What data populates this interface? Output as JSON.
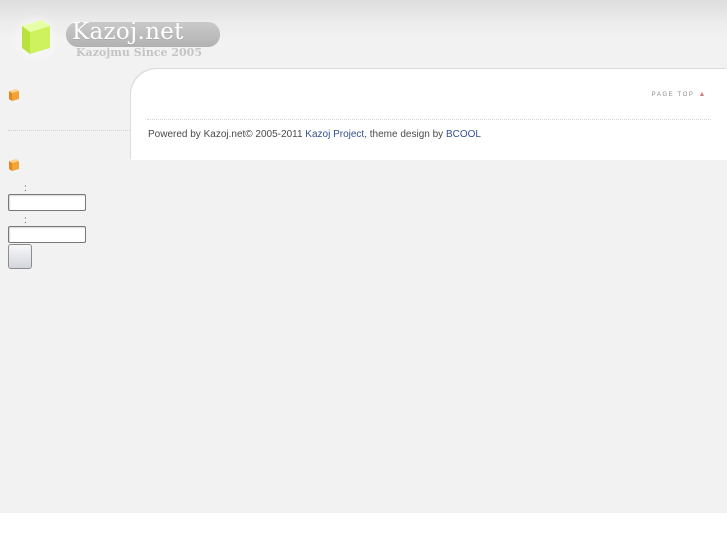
{
  "header": {
    "site_title": "Kazoj.net",
    "site_tagline": "Kazojmu Since 2005"
  },
  "sidebar": {
    "login": {
      "username_colon": ":",
      "password_colon": ":",
      "username_value": "",
      "password_value": "",
      "submit_label": ""
    }
  },
  "main": {
    "page_top_label": "PAGE TOP",
    "page_top_arrow": "▲",
    "footer": {
      "powered_text": "Powered by Kazoj.net© 2005-2011 ",
      "project_link": "Kazoj Project",
      "theme_text": ", theme design by ",
      "theme_link": "BCOOL"
    }
  },
  "colors": {
    "background": "#f2f2f2",
    "panel": "#ffffff",
    "link": "#34508f",
    "logo_green": "#c8f25a",
    "bullet_orange": "#f4a236"
  },
  "icons": {
    "logo": "green-cube-icon",
    "sidebar_bullet": "orange-cube-bullet-icon",
    "page_top": "triangle-up-icon"
  }
}
